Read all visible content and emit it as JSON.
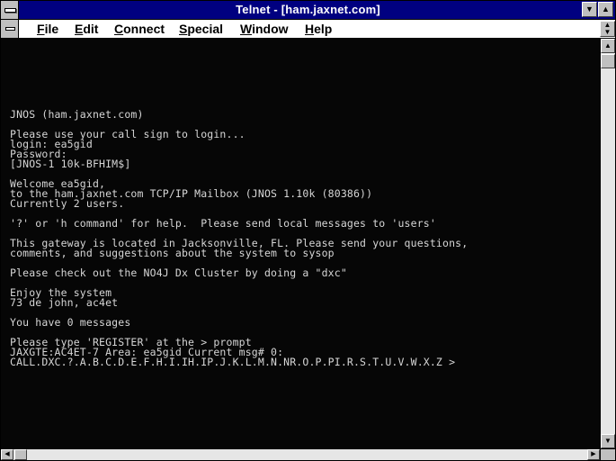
{
  "window": {
    "title": "Telnet - [ham.jaxnet.com]"
  },
  "menu": {
    "items": [
      {
        "accel": "F",
        "rest": "ile"
      },
      {
        "accel": "E",
        "rest": "dit"
      },
      {
        "accel": "C",
        "rest": "onnect"
      },
      {
        "accel": "S",
        "rest": "pecial"
      },
      {
        "accel": "W",
        "rest": "indow"
      },
      {
        "accel": "H",
        "rest": "elp"
      }
    ]
  },
  "icons": {
    "minimize": "down-triangle-icon",
    "maximize": "up-triangle-icon",
    "restore": "restore-arrows-icon",
    "scroll_up": "up-arrow-icon",
    "scroll_down": "down-arrow-icon",
    "scroll_left": "left-arrow-icon",
    "scroll_right": "right-arrow-icon"
  },
  "colors": {
    "title_bar": "#000080",
    "terminal_bg": "#060606",
    "terminal_fg": "#d6d6d6"
  },
  "terminal": {
    "lines": [
      "JNOS (ham.jaxnet.com)",
      "",
      "Please use your call sign to login...",
      "login: ea5gid",
      "Password:",
      "[JNOS-1 10k-BFHIM$]",
      "",
      "Welcome ea5gid,",
      "to the ham.jaxnet.com TCP/IP Mailbox (JNOS 1.10k (80386))",
      "Currently 2 users.",
      "",
      "'?' or 'h command' for help.  Please send local messages to 'users'",
      "",
      "This gateway is located in Jacksonville, FL. Please send your questions,",
      "comments, and suggestions about the system to sysop",
      "",
      "Please check out the NO4J Dx Cluster by doing a \"dxc\"",
      "",
      "Enjoy the system",
      "73 de john, ac4et",
      "",
      "You have 0 messages",
      "",
      "Please type 'REGISTER' at the > prompt",
      "JAXGTE:AC4ET-7 Area: ea5gid Current msg# 0:",
      "CALL.DXC.?.A.B.C.D.E.F.H.I.IH.IP.J.K.L.M.N.NR.O.P.PI.R.S.T.U.V.W.X.Z >"
    ]
  }
}
